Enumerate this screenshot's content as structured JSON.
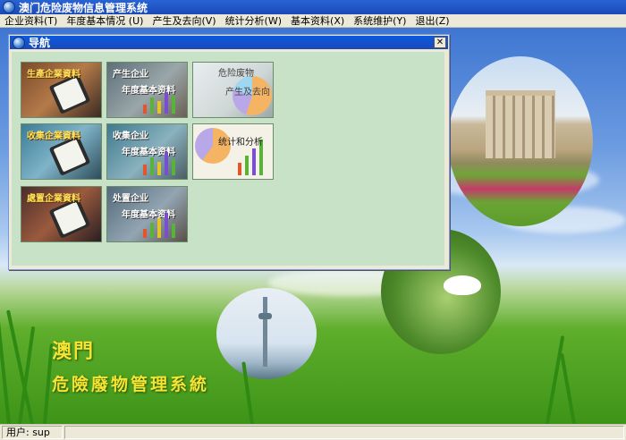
{
  "window": {
    "title": "澳门危险废物信息管理系统"
  },
  "menu": [
    {
      "label": "企业资料(T)"
    },
    {
      "label": "年度基本情况 (U)"
    },
    {
      "label": "产生及去向(V)"
    },
    {
      "label": "统计分析(W)"
    },
    {
      "label": "基本资料(X)"
    },
    {
      "label": "系统维护(Y)"
    },
    {
      "label": "退出(Z)"
    }
  ],
  "nav": {
    "title": "导航",
    "close": "✕",
    "tiles": [
      {
        "line1": "生產企業資料"
      },
      {
        "line1": "产生企业",
        "line2": "年度基本资料"
      },
      {
        "line1": "危险废物",
        "line2": "产生及去向"
      },
      {
        "line1": "收集企業資料"
      },
      {
        "line1": "收集企业",
        "line2": "年度基本资料"
      },
      {
        "line1": "统计和分析"
      },
      {
        "line1": "處置企業資料"
      },
      {
        "line1": "处置企业",
        "line2": "年度基本资料"
      }
    ]
  },
  "desktop": {
    "logo_line1": "澳門",
    "logo_line2": "危險廢物管理系統"
  },
  "status": {
    "user": "用户: sup"
  },
  "colors": {
    "nav_bg": "#c8e2c8",
    "titlebar": "#1a4bb8",
    "logo_text": "#f7e332"
  }
}
